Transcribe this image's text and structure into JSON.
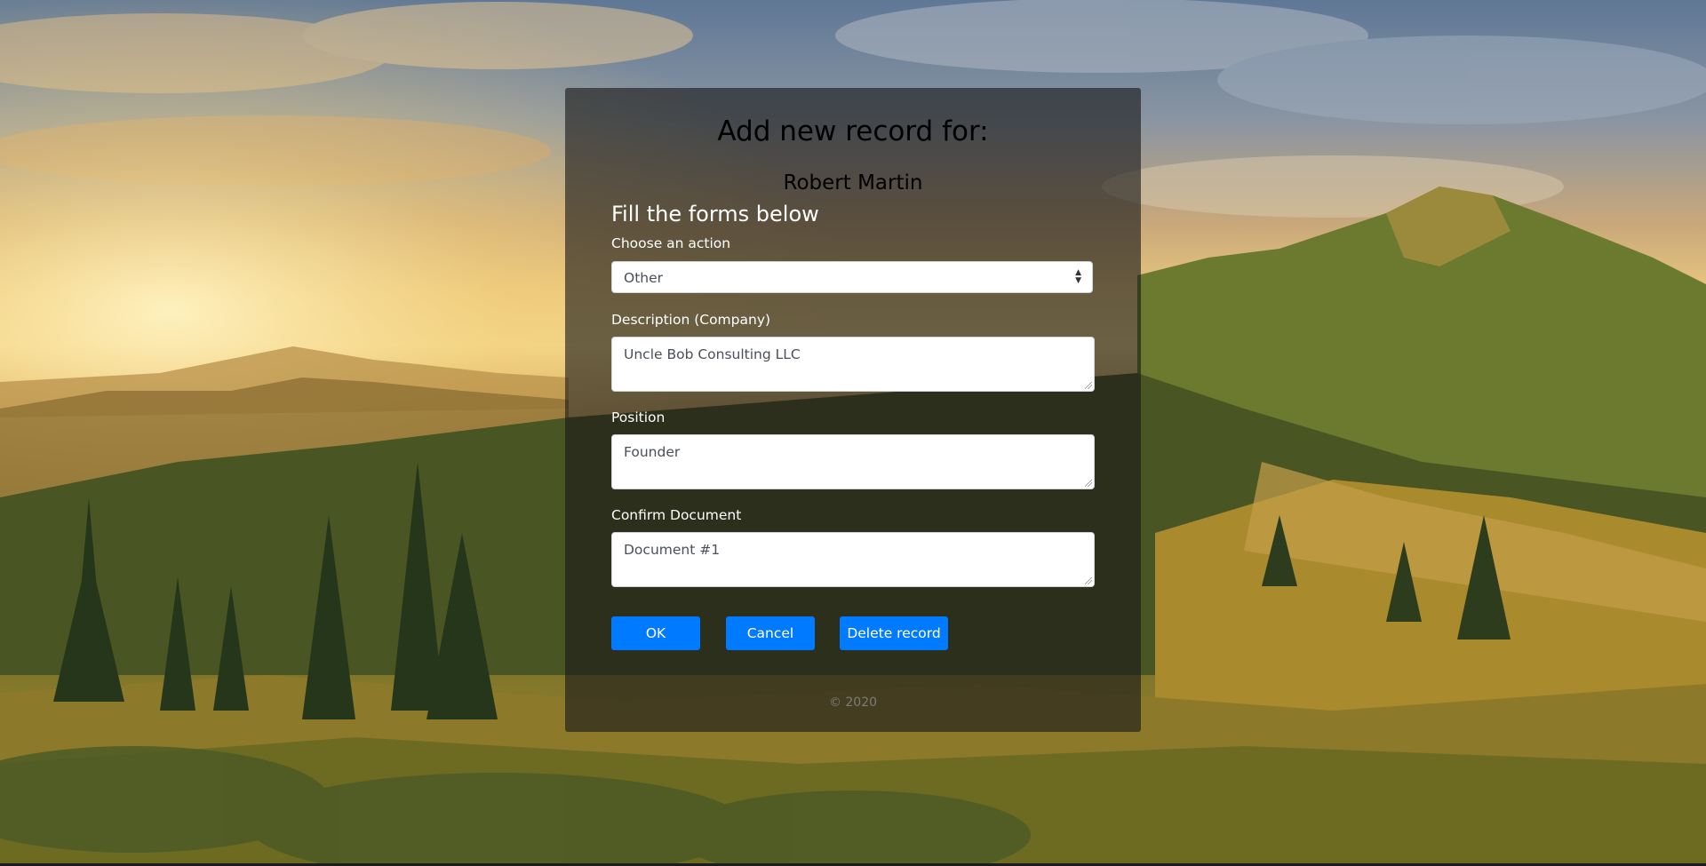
{
  "header": {
    "title": "Add new record for:",
    "person_name": "Robert Martin"
  },
  "form": {
    "section_title": "Fill the forms below",
    "action": {
      "label": "Choose an action",
      "selected": "Other"
    },
    "description": {
      "label": "Description (Company)",
      "value": "Uncle Bob Consulting LLC"
    },
    "position": {
      "label": "Position",
      "value": "Founder"
    },
    "confirm_document": {
      "label": "Confirm Document",
      "value": "Document #1"
    }
  },
  "buttons": {
    "ok": "OK",
    "cancel": "Cancel",
    "delete": "Delete record"
  },
  "footer": {
    "text": "© 2020"
  },
  "colors": {
    "primary": "#007bff",
    "card_overlay": "rgba(25,25,25,0.62)",
    "text": "#ffffff"
  },
  "icons": {
    "select_arrow": "sort-icon"
  }
}
